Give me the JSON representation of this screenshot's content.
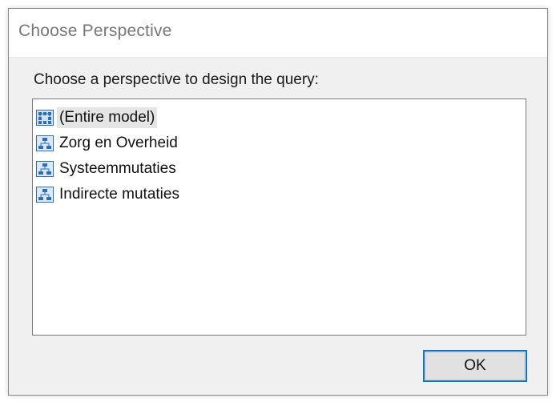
{
  "dialog": {
    "title": "Choose Perspective",
    "prompt": "Choose a perspective to design the query:",
    "items": [
      {
        "label": "(Entire model)",
        "icon": "entire-model-icon",
        "selected": true
      },
      {
        "label": "Zorg en Overheid",
        "icon": "perspective-icon",
        "selected": false
      },
      {
        "label": "Systeemmutaties",
        "icon": "perspective-icon",
        "selected": false
      },
      {
        "label": "Indirecte mutaties",
        "icon": "perspective-icon",
        "selected": false
      }
    ],
    "ok_label": "OK"
  },
  "colors": {
    "accent": "#0a74d1",
    "icon_blue": "#2b6fb7",
    "selection": "#e5e5e5",
    "dialog_bg": "#f0f0f0"
  }
}
